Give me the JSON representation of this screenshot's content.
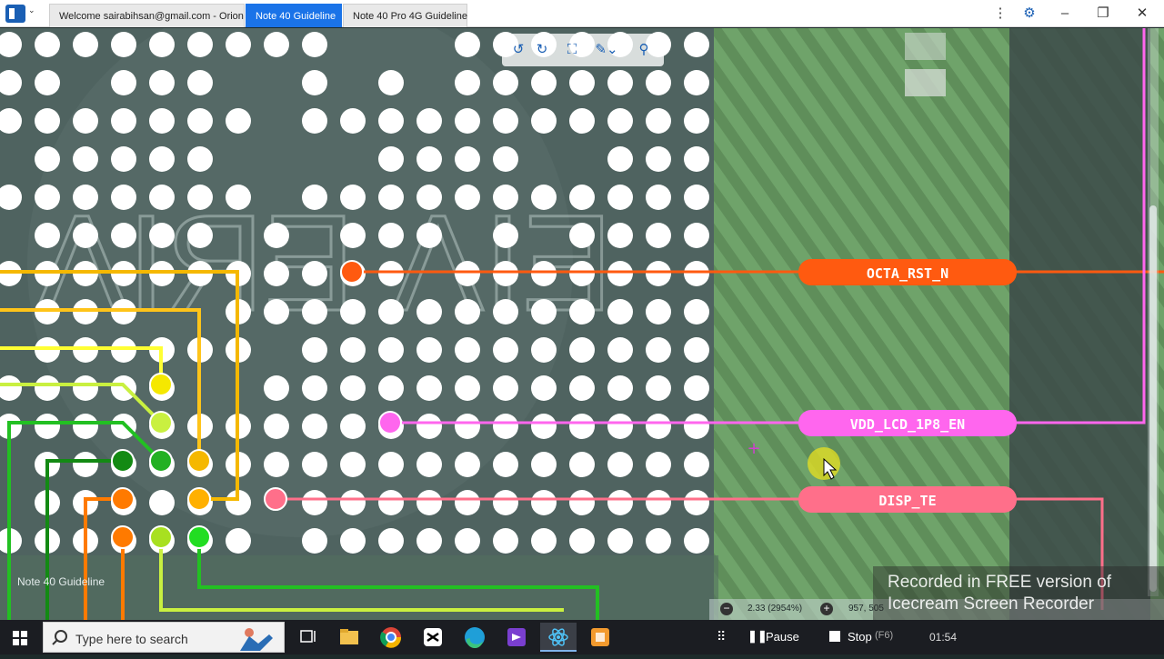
{
  "window": {
    "tabs": [
      {
        "label": "Welcome sairabihsan@gmail.com - Orion",
        "active": false
      },
      {
        "label": "Note 40 Guideline",
        "active": true
      },
      {
        "label": "Note 40 Pro 4G Guideline",
        "active": false
      }
    ],
    "controls": {
      "more_icon": "vertical-dots-icon",
      "settings_icon": "gear-icon",
      "minimize": "–",
      "restore": "❐",
      "close": "✕"
    },
    "accent_color": "#1a73e8"
  },
  "viewer": {
    "document_label": "Note 40 Guideline",
    "toolbar_icons": [
      "rotate-left-icon",
      "rotate-right-icon",
      "fit-screen-icon",
      "measure-icon",
      "zoom-icon"
    ],
    "zoom_readout": "2.33 (2954%)",
    "coord_readout": "957, 505",
    "signals": [
      {
        "name": "OCTA_RST_N",
        "color": "#ff5a10"
      },
      {
        "name": "VDD_LCD_1P8_EN",
        "color": "#ff66ee"
      },
      {
        "name": "DISP_TE",
        "color": "#ff6f8a"
      }
    ],
    "trace_colors": [
      "#f5b800",
      "#f5d000",
      "#ffff33",
      "#c9f040",
      "#22c022",
      "#138a13",
      "#ff7a00",
      "#ffc419"
    ],
    "board_text": [
      "ɅIЯƎ ɅIƎ"
    ]
  },
  "recorder": {
    "watermark": "Recorded in FREE version of Icecream Screen Recorder",
    "pause_label": "Pause",
    "stop_label": "Stop",
    "stop_hint": "(F6)",
    "timer": "01:54"
  },
  "taskbar": {
    "search_placeholder": "Type here to search",
    "pinned": [
      "task-view-icon",
      "file-explorer-icon",
      "chrome-icon",
      "capcut-icon",
      "edge-icon",
      "visual-studio-icon",
      "electron-app-icon",
      "orion-icon"
    ]
  }
}
